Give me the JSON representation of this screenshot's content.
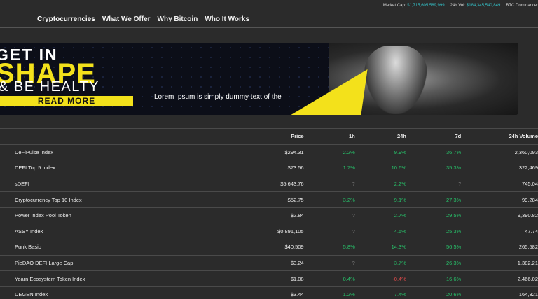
{
  "ticker": {
    "market_cap_label": "Market Cap:",
    "market_cap_value": "$1,715,605,589,999",
    "vol_label": "24h Vol:",
    "vol_value": "$184,345,540,849",
    "dominance_label": "BTC Dominance:"
  },
  "nav": {
    "items": [
      "Cryptocurrencies",
      "What We Offer",
      "Why Bitcoin",
      "Who It Works"
    ]
  },
  "banner": {
    "line1": "GET IN",
    "line2": "SHAPE",
    "line3": "& BE HEALTY",
    "button": "READ MORE",
    "text": "Lorem Ipsum is simply dummy text of the"
  },
  "table": {
    "headers": [
      "",
      "Price",
      "1h",
      "24h",
      "7d",
      "24h Volume"
    ],
    "rows": [
      {
        "name": "DeFiPulse Index",
        "price": "$294.31",
        "h1": "2.2%",
        "h24": "9.9%",
        "d7": "36.7%",
        "vol": "2,360,093",
        "h1_c": "pos",
        "h24_c": "pos",
        "d7_c": "pos"
      },
      {
        "name": "DEFI Top 5 Index",
        "price": "$73.56",
        "h1": "1.7%",
        "h24": "10.6%",
        "d7": "35.3%",
        "vol": "322,469",
        "h1_c": "pos",
        "h24_c": "pos",
        "d7_c": "pos"
      },
      {
        "name": "sDEFI",
        "price": "$5,643.76",
        "h1": "?",
        "h24": "2.2%",
        "d7": "?",
        "vol": "745.04",
        "h1_c": "dim",
        "h24_c": "pos",
        "d7_c": "dim"
      },
      {
        "name": "Cryptocurrency Top 10 Index",
        "price": "$52.75",
        "h1": "3.2%",
        "h24": "9.1%",
        "d7": "27.3%",
        "vol": "99,284",
        "h1_c": "pos",
        "h24_c": "pos",
        "d7_c": "pos"
      },
      {
        "name": "Power Index Pool Token",
        "price": "$2.84",
        "h1": "?",
        "h24": "2.7%",
        "d7": "29.5%",
        "vol": "9,390.82",
        "h1_c": "dim",
        "h24_c": "pos",
        "d7_c": "pos"
      },
      {
        "name": "ASSY Index",
        "price": "$0.891,105",
        "h1": "?",
        "h24": "4.5%",
        "d7": "25.3%",
        "vol": "47.74",
        "h1_c": "dim",
        "h24_c": "pos",
        "d7_c": "pos"
      },
      {
        "name": "Punk Basic",
        "price": "$40,509",
        "h1": "5.8%",
        "h24": "14.3%",
        "d7": "56.5%",
        "vol": "265,582",
        "h1_c": "pos",
        "h24_c": "pos",
        "d7_c": "pos"
      },
      {
        "name": "PieDAO DEFI Large Cap",
        "price": "$3.24",
        "h1": "?",
        "h24": "3.7%",
        "d7": "26.3%",
        "vol": "1,382.21",
        "h1_c": "dim",
        "h24_c": "pos",
        "d7_c": "pos"
      },
      {
        "name": "Yearn Ecosystem Token Index",
        "price": "$1.08",
        "h1": "0.4%",
        "h24": "-0.4%",
        "d7": "16.6%",
        "vol": "2,466.02",
        "h1_c": "pos",
        "h24_c": "neg",
        "d7_c": "pos"
      },
      {
        "name": "DEGEN Index",
        "price": "$3.44",
        "h1": "1.2%",
        "h24": "7.4%",
        "d7": "20.6%",
        "vol": "164,321",
        "h1_c": "pos",
        "h24_c": "pos",
        "d7_c": "pos"
      }
    ]
  },
  "colors": {
    "accent": "#f3e11b",
    "positive": "#27c26a",
    "negative": "#ea4d4d",
    "ticker_value": "#34c3c9"
  }
}
